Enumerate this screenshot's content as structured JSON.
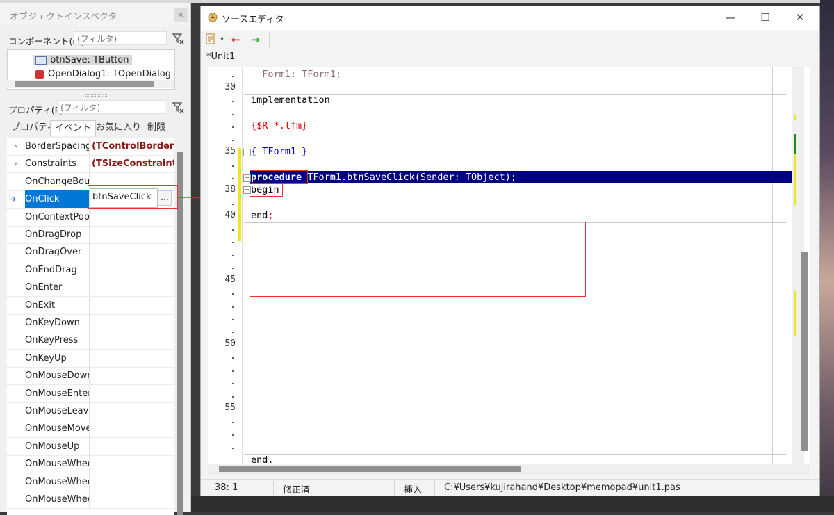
{
  "inspector": {
    "title": "オブジェクトインスペクタ",
    "close": "×",
    "components_label": "コンポーネント(m)",
    "components_filter_placeholder": "(フィルタ)",
    "tree_items": [
      "btnSave: TButton",
      "OpenDialog1: TOpenDialog"
    ],
    "properties_label": "プロパティ(P)",
    "properties_filter_placeholder": "(フィルタ)",
    "tabs": [
      "プロパティ",
      "イベント",
      "お気に入り",
      "制限"
    ],
    "active_tab": "イベント",
    "rows": [
      {
        "name": "BorderSpacing",
        "value": "(TControlBorderSpacing)",
        "expand": "›"
      },
      {
        "name": "Constraints",
        "value": "(TSizeConstraints)",
        "expand": "›"
      },
      {
        "name": "OnChangeBounds",
        "value": ""
      },
      {
        "name": "OnClick",
        "value": "btnSaveClick"
      },
      {
        "name": "OnContextPopup",
        "value": ""
      },
      {
        "name": "OnDragDrop",
        "value": ""
      },
      {
        "name": "OnDragOver",
        "value": ""
      },
      {
        "name": "OnEndDrag",
        "value": ""
      },
      {
        "name": "OnEnter",
        "value": ""
      },
      {
        "name": "OnExit",
        "value": ""
      },
      {
        "name": "OnKeyDown",
        "value": ""
      },
      {
        "name": "OnKeyPress",
        "value": ""
      },
      {
        "name": "OnKeyUp",
        "value": ""
      },
      {
        "name": "OnMouseDown",
        "value": ""
      },
      {
        "name": "OnMouseEnter",
        "value": ""
      },
      {
        "name": "OnMouseLeave",
        "value": ""
      },
      {
        "name": "OnMouseMove",
        "value": ""
      },
      {
        "name": "OnMouseUp",
        "value": ""
      },
      {
        "name": "OnMouseWheel",
        "value": ""
      },
      {
        "name": "OnMouseWheelDown",
        "value": ""
      },
      {
        "name": "OnMouseWheelUp",
        "value": ""
      }
    ],
    "onclick_value": "btnSaveClick",
    "ellipsis": "..."
  },
  "editor": {
    "title": "ソースエディタ",
    "window_buttons": {
      "minimize": "—",
      "maximize": "☐",
      "close": "✕"
    },
    "tab_label": "*Unit1",
    "line_numbers": {
      "30": "30",
      "35": "35",
      "38": "38",
      "40": "40",
      "45": "45",
      "50": "50",
      "55": "55"
    },
    "code": {
      "form_var": "  Form1: TForm1;",
      "implementation": "implementation",
      "directive": "{$R *.lfm}",
      "comment": "{ TForm1 }",
      "procedure_kw": "procedure",
      "procedure_rest": " TForm1.btnSaveClick(Sender: TObject);",
      "begin": "begin",
      "end_kw": "end",
      "end_semi": ";",
      "final_end": "end."
    },
    "status": {
      "position": "38:  1",
      "modified": "修正済",
      "mode": "挿入",
      "path": "C:¥Users¥kujirahand¥Desktop¥memopad¥unit1.pas"
    }
  },
  "colors": {
    "selection": "#0078d7",
    "highlight_frame": "#e33333",
    "directive": "#e00000",
    "comment": "#0000c8",
    "event_value": "#8b1a1a"
  }
}
